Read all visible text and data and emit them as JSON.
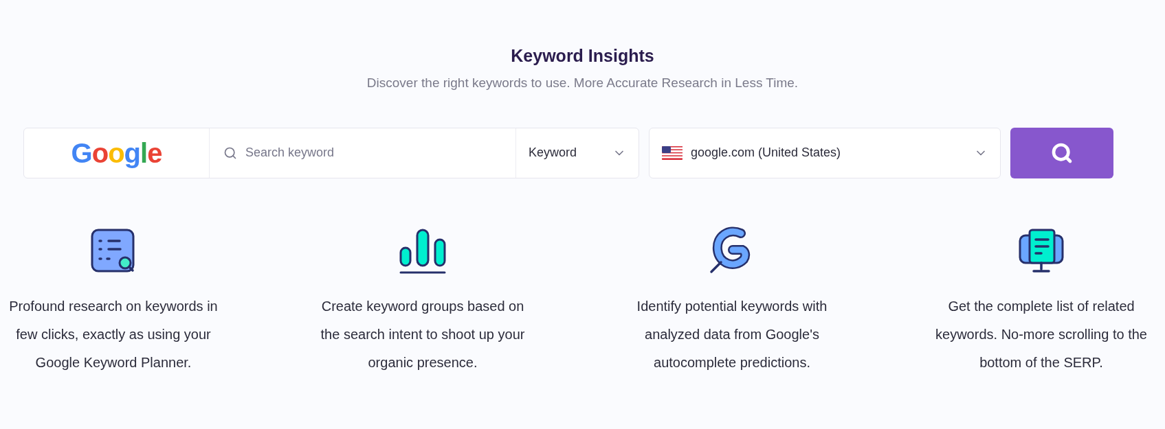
{
  "header": {
    "title": "Keyword Insights",
    "subtitle": "Discover the right keywords to use. More Accurate Research in Less Time."
  },
  "search": {
    "engine_logo": "Google",
    "placeholder": "Search keyword",
    "mode": "Keyword",
    "location": "google.com (United States)"
  },
  "features": [
    {
      "kind": "list",
      "text": "Profound research on keywords in few clicks, exactly as using your Google Keyword Planner."
    },
    {
      "kind": "bars",
      "text": "Create keyword groups based on the search intent to shoot up your organic presence."
    },
    {
      "kind": "g",
      "text": "Identify potential keywords with analyzed data from Google's autocomplete predictions."
    },
    {
      "kind": "monitor",
      "text": "Get the complete list of related keywords. No-more scrolling to the bottom of the SERP."
    }
  ]
}
